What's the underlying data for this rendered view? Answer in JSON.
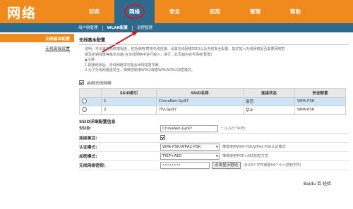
{
  "brand": "网络",
  "nav": {
    "tabs": [
      {
        "label": "状态"
      },
      {
        "label": "网络"
      },
      {
        "label": "安全"
      },
      {
        "label": "应用"
      },
      {
        "label": "管理"
      },
      {
        "label": "帮助"
      }
    ],
    "active_tab": "网络"
  },
  "subnav": {
    "items": [
      {
        "label": "用户侧管理"
      },
      {
        "label": "WLAN配置"
      },
      {
        "label": "远程管理"
      }
    ],
    "active": "WLAN配置"
  },
  "sidebar": {
    "items": [
      {
        "label": "无线基本配置",
        "active": true
      },
      {
        "label": "无线高级设置",
        "active": false
      }
    ]
  },
  "main": {
    "section_title": "无线基本配置",
    "desc_lines": [
      "说明：可设置无线终端相连，包括使用/禁用无线连接、设置无线网络SSID以及无线安全配置、指定加入无线网络是否需要网络密",
      "钥及密钥强度等基本功能(在无线网络中进行接入，进行，此页面内容可保存/配置)",
      "▲注意:",
      "1.配置修改后，无线网络将可能会出现短暂中断。",
      "2.为了无线网络更安全，推荐您使用WPA2或者WPA/WPA2加密模式。"
    ],
    "enable_label": "启用无线网络",
    "enable_checked": true,
    "table": {
      "headers": [
        "",
        "SSID索引",
        "SSID名称",
        "连接状态",
        "安全配置"
      ],
      "rows": [
        {
          "index": "1",
          "name": "ChinaNet-Gp97",
          "status": "激活",
          "security": "WPA-PSK",
          "selected": true
        },
        {
          "index": "2",
          "name": "iTV-Gp97",
          "status": "禁止",
          "security": "WPA-PSK",
          "selected": false
        }
      ]
    },
    "detail_title": "SSID详细配置信息",
    "form": {
      "ssid_label": "SSID:",
      "ssid_value": "ChinaNet-Gp97",
      "ssid_hint": "* (1-32个字符)",
      "connect_label": "连接激活:",
      "connect_checked": true,
      "auth_label": "认证模式:",
      "auth_value": "WPA-PSK/WPA2-PSK",
      "auth_hint": "推荐使用WPA-PSK/WPA2-PSK认证模式",
      "enc_label": "加密模式:",
      "enc_value": "TKIP+AES",
      "enc_hint": "推荐使用TKIP+AES加密方式",
      "key_label": "无线网络密钥:",
      "key_value": "••••••••",
      "show_key_button": "点击显示密码",
      "key_hint": "(8-63个字符或者64个十六进制字符)"
    }
  },
  "watermark": "Baidu 百 经验",
  "colors": {
    "header_orange": "#f08a1c",
    "nav_blue": "#2e6a8c",
    "highlight_red": "#c0202a"
  }
}
